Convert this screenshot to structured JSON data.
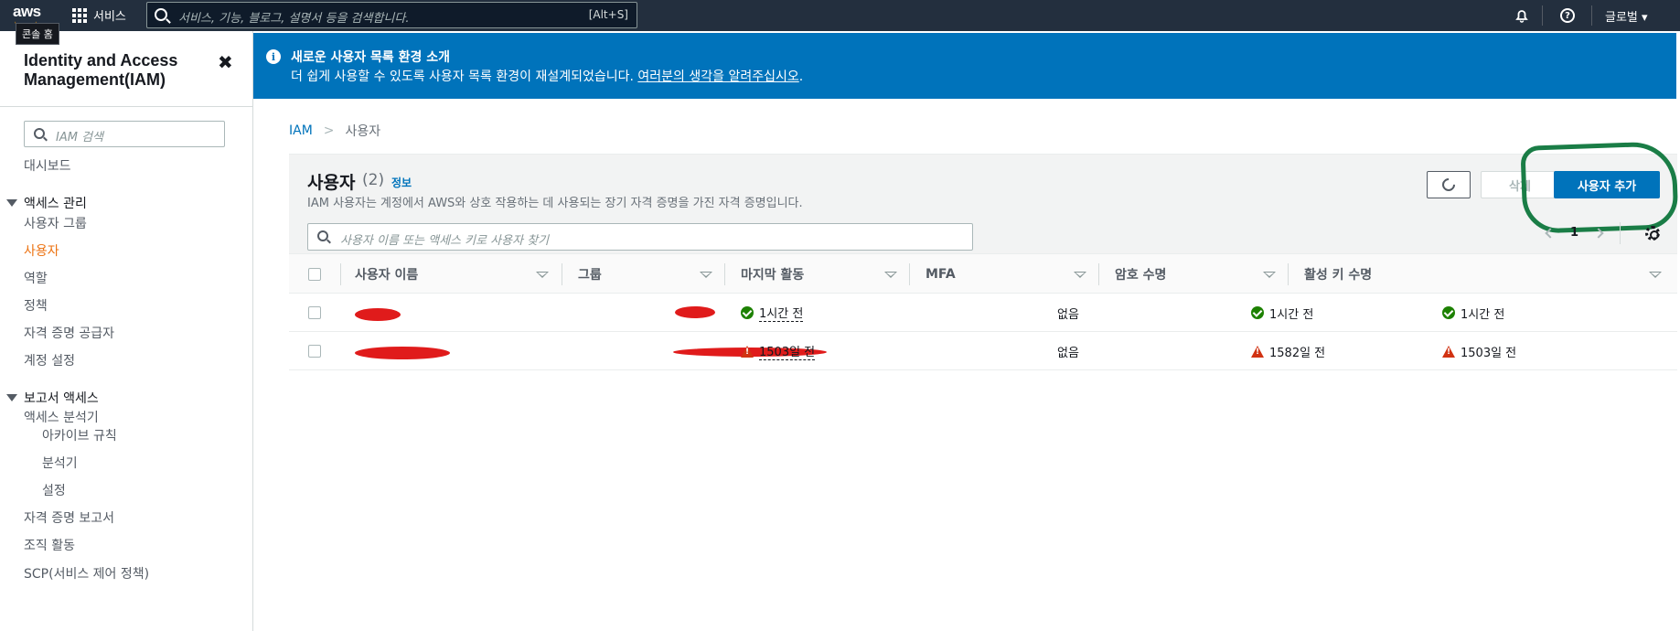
{
  "topnav": {
    "logo": "aws",
    "home_tooltip": "콘솔 홈",
    "services_label": "서비스",
    "search_placeholder": "서비스, 기능, 블로그, 설명서 등을 검색합니다.",
    "search_shortcut": "[Alt+S]",
    "region_label": "글로벌 ▾",
    "help_glyph": "?",
    "icons": [
      "grid-icon",
      "search-icon",
      "bell-icon",
      "help-icon"
    ]
  },
  "sidebar": {
    "title": "Identity and Access Management(IAM)",
    "close_glyph": "✖",
    "search_placeholder": "IAM 검색",
    "dashboard": "대시보드",
    "access_mgmt": {
      "label": "액세스 관리",
      "items": [
        "사용자 그룹",
        "사용자",
        "역할",
        "정책",
        "자격 증명 공급자",
        "계정 설정"
      ]
    },
    "reports": {
      "label": "보고서 액세스",
      "analyzer": "액세스 분석기",
      "analyzer_items": [
        "아카이브 규칙",
        "분석기",
        "설정"
      ],
      "items": [
        "자격 증명 보고서",
        "조직 활동",
        "SCP(서비스 제어 정책)"
      ]
    }
  },
  "banner": {
    "info_glyph": "i",
    "title": "새로운 사용자 목록 환경 소개",
    "text": "더 쉽게 사용할 수 있도록 사용자 목록 환경이 재설계되었습니다. ",
    "link": "여러분의 생각을 알려주십시오",
    "end": "."
  },
  "breadcrumb": {
    "root": "IAM",
    "sep": ">",
    "current": "사용자"
  },
  "users": {
    "title": "사용자",
    "count": "(2)",
    "info": "정보",
    "description": "IAM 사용자는 계정에서 AWS와 상호 작용하는 데 사용되는 장기 자격 증명을 가진 자격 증명입니다.",
    "delete_label": "삭제",
    "add_label": "사용자 추가",
    "search_placeholder": "사용자 이름 또는 액세스 키로 사용자 찾기",
    "page": "1",
    "columns": [
      "사용자 이름",
      "그룹",
      "마지막 활동",
      "MFA",
      "암호 수명",
      "활성 키 수명"
    ],
    "rows": [
      {
        "last_activity": "1시간 전",
        "last_status": "ok",
        "mfa": "없음",
        "password_age": "1시간 전",
        "password_status": "ok",
        "key_age": "1시간 전",
        "key_status": "ok"
      },
      {
        "last_activity": "1503일 전",
        "last_status": "warn",
        "mfa": "없음",
        "password_age": "1582일 전",
        "password_status": "warn",
        "key_age": "1503일 전",
        "key_status": "warn"
      }
    ]
  },
  "colors": {
    "nav_bg": "#232f3e",
    "banner_bg": "#0073bb",
    "primary_button": "#0073bb",
    "active_link": "#ec7211",
    "ok": "#1d8102",
    "warn": "#d13212",
    "annotation_circle": "#1a7d46",
    "redaction": "#e01b1b"
  }
}
